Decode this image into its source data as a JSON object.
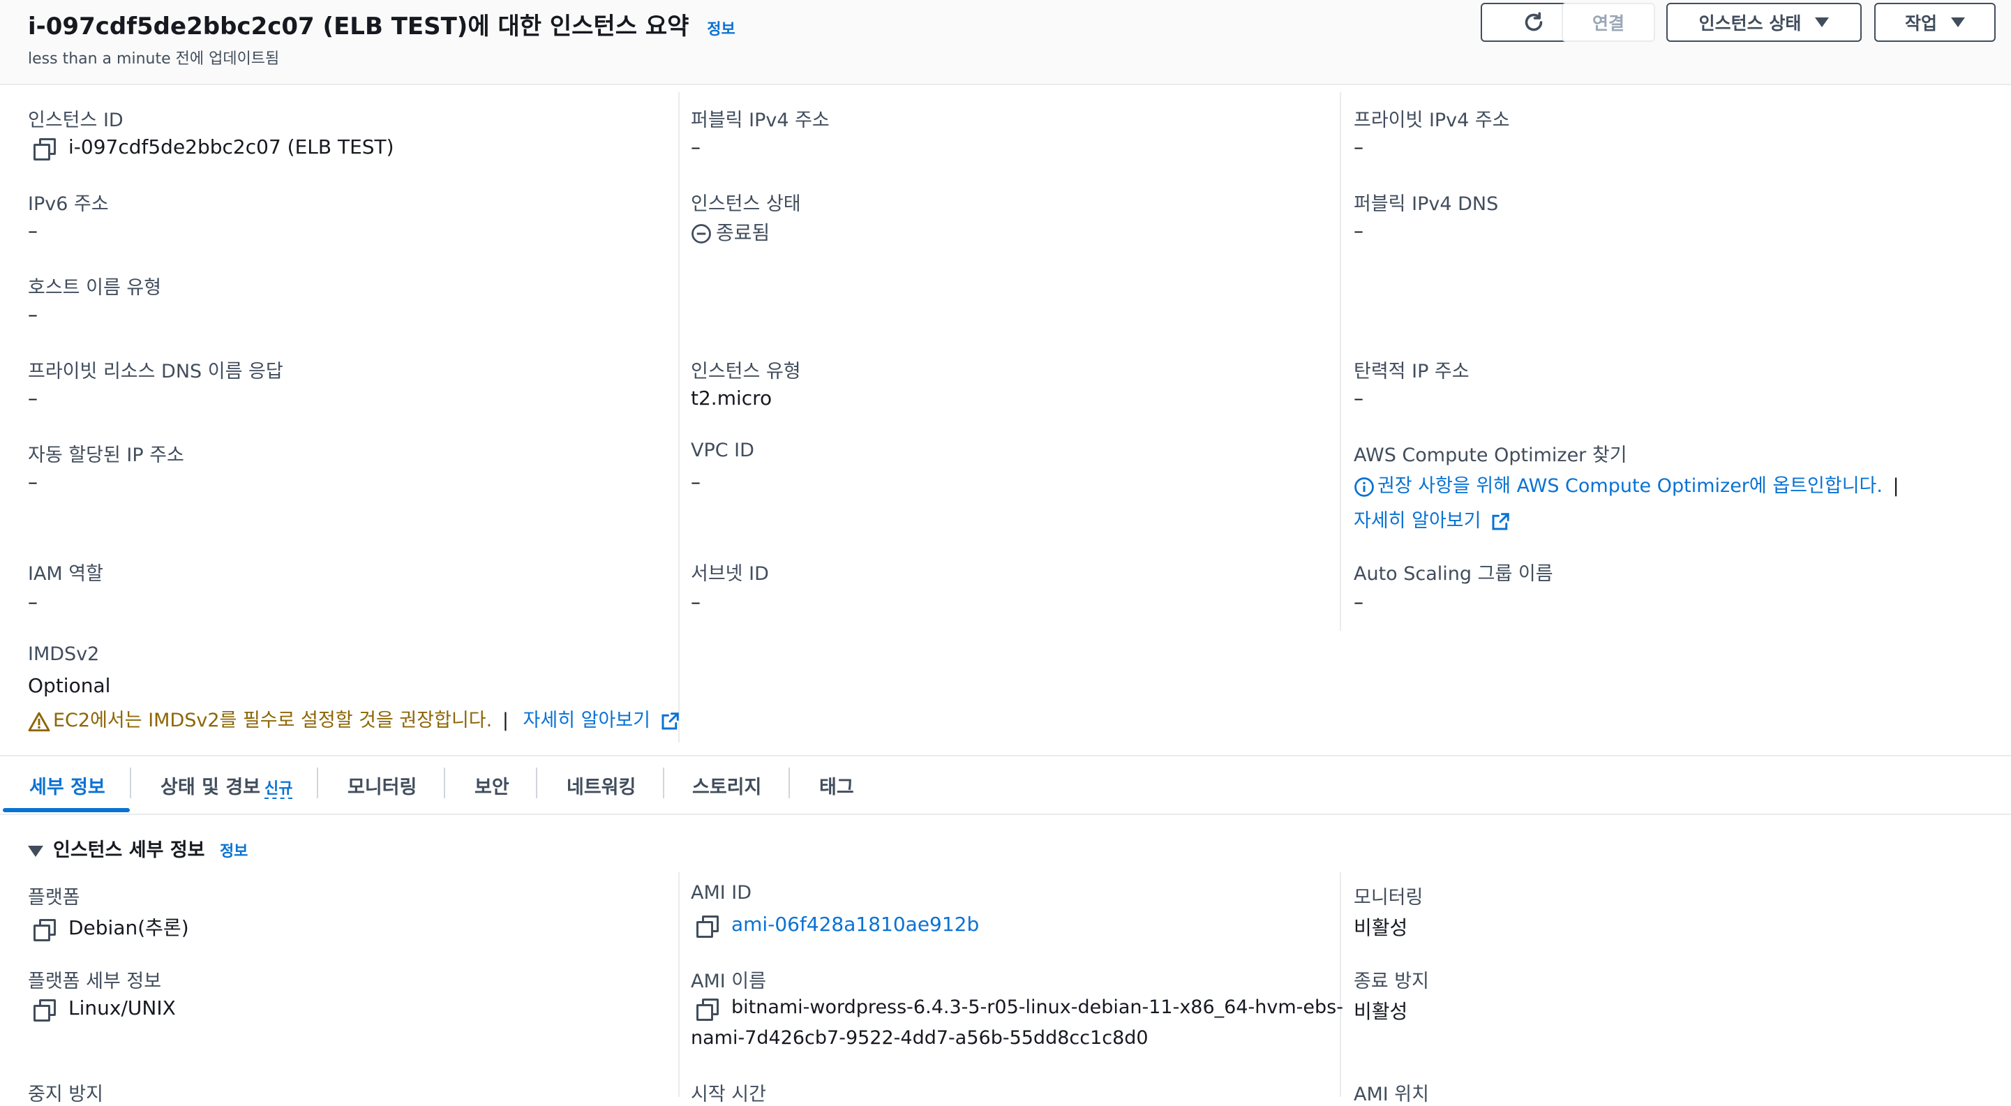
{
  "header": {
    "title": "i-097cdf5de2bbc2c07 (ELB TEST)에 대한 인스턴스 요약",
    "info_link": "정보",
    "subtitle": "less than a minute 전에 업데이트됨",
    "buttons": {
      "refresh_icon": "refresh-icon",
      "connect": "연결",
      "instance_state": "인스턴스 상태",
      "actions": "작업"
    }
  },
  "summary": {
    "instance_id": {
      "label": "인스턴스 ID",
      "value": "i-097cdf5de2bbc2c07 (ELB TEST)"
    },
    "public_ipv4": {
      "label": "퍼블릭 IPv4 주소",
      "value": "–"
    },
    "private_ipv4": {
      "label": "프라이빗 IPv4 주소",
      "value": "–"
    },
    "ipv6": {
      "label": "IPv6 주소",
      "value": "–"
    },
    "instance_state": {
      "label": "인스턴스 상태",
      "value": "종료됨"
    },
    "public_dns": {
      "label": "퍼블릭 IPv4 DNS",
      "value": "–"
    },
    "hostname_type": {
      "label": "호스트 이름 유형",
      "value": "–"
    },
    "private_dns_answer": {
      "label": "프라이빗 리소스 DNS 이름 응답",
      "value": "–"
    },
    "instance_type": {
      "label": "인스턴스 유형",
      "value": "t2.micro"
    },
    "elastic_ip": {
      "label": "탄력적 IP 주소",
      "value": "–"
    },
    "auto_ip": {
      "label": "자동 할당된 IP 주소",
      "value": "–"
    },
    "vpc_id": {
      "label": "VPC ID",
      "value": "–"
    },
    "optimizer": {
      "label": "AWS Compute Optimizer 찾기",
      "message": "권장 사항을 위해 AWS Compute Optimizer에 옵트인합니다.",
      "separator": "|",
      "learn_more": "자세히 알아보기"
    },
    "iam_role": {
      "label": "IAM 역할",
      "value": "–"
    },
    "subnet_id": {
      "label": "서브넷 ID",
      "value": "–"
    },
    "asg_name": {
      "label": "Auto Scaling 그룹 이름",
      "value": "–"
    },
    "imdsv2": {
      "label": "IMDSv2",
      "value": "Optional",
      "warning": "EC2에서는 IMDSv2를 필수로 설정할 것을 권장합니다.",
      "separator": "|",
      "learn_more": "자세히 알아보기"
    }
  },
  "tabs": [
    {
      "label": "세부 정보"
    },
    {
      "label": "상태 및 경보",
      "badge": "신규"
    },
    {
      "label": "모니터링"
    },
    {
      "label": "보안"
    },
    {
      "label": "네트워킹"
    },
    {
      "label": "스토리지"
    },
    {
      "label": "태그"
    }
  ],
  "details": {
    "section_title": "인스턴스 세부 정보",
    "info_link": "정보",
    "platform": {
      "label": "플랫폼",
      "value": "Debian(추론)"
    },
    "ami_id": {
      "label": "AMI ID",
      "value": "ami-06f428a1810ae912b"
    },
    "monitoring": {
      "label": "모니터링",
      "value": "비활성"
    },
    "platform_details": {
      "label": "플랫폼 세부 정보",
      "value": "Linux/UNIX"
    },
    "ami_name": {
      "label": "AMI 이름",
      "value_line1": "bitnami-wordpress-6.4.3-5-r05-linux-debian-11-x86_64-hvm-ebs-",
      "value_line2": "nami-7d426cb7-9522-4dd7-a56b-55dd8cc1c8d0"
    },
    "termination_protection": {
      "label": "종료 방지",
      "value": "비활성"
    },
    "stop_protection": {
      "label": "중지 방지"
    },
    "launch_time": {
      "label": "시작 시간"
    },
    "ami_location": {
      "label": "AMI 위치"
    }
  },
  "colors": {
    "link": "#0972d3",
    "warning": "#8d6605",
    "text": "#16191f",
    "muted": "#414d5c"
  }
}
